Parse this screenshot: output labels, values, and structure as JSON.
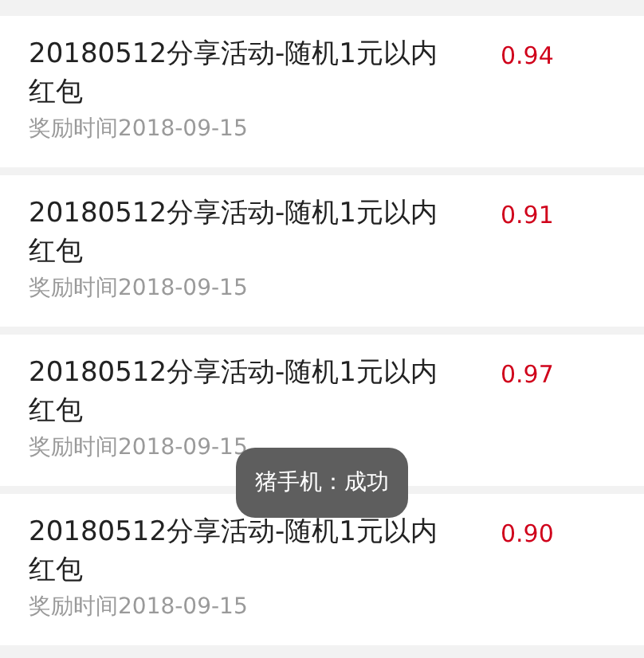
{
  "records": [
    {
      "title": "20180512分享活动-随机1元以内红包",
      "date": "奖励时间2018-09-15",
      "amount": "0.94"
    },
    {
      "title": "20180512分享活动-随机1元以内红包",
      "date": "奖励时间2018-09-15",
      "amount": "0.91"
    },
    {
      "title": "20180512分享活动-随机1元以内红包",
      "date": "奖励时间2018-09-15",
      "amount": "0.97"
    },
    {
      "title": "20180512分享活动-随机1元以内红包",
      "date": "奖励时间2018-09-15",
      "amount": "0.90"
    }
  ],
  "toast": {
    "text": "猪手机：成功"
  }
}
